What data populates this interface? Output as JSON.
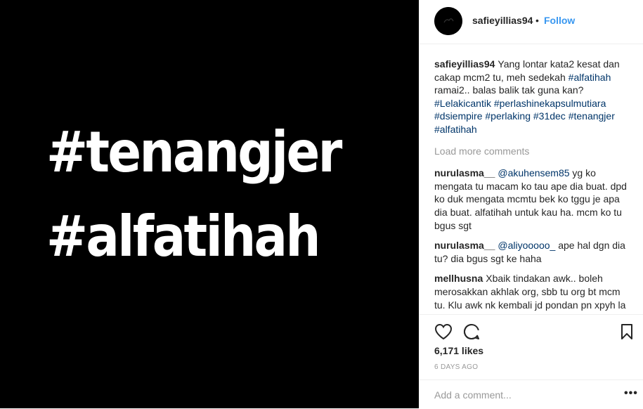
{
  "post_image": {
    "line1": "#tenangjer",
    "line2": "#alfatihah"
  },
  "header": {
    "username": "safieyillias94",
    "separator": "•",
    "follow_label": "Follow",
    "avatar_icon": "avatar-icon"
  },
  "caption": {
    "username": "safieyillias94",
    "segments": [
      {
        "type": "text",
        "text": "Yang lontar kata2 kesat dan cakap mcm2 tu, meh sedekah "
      },
      {
        "type": "hashtag",
        "text": "#alfatihah"
      },
      {
        "type": "text",
        "text": " ramai2.. balas balik tak guna kan? "
      },
      {
        "type": "hashtag",
        "text": "#Lelakicantik"
      },
      {
        "type": "text",
        "text": " "
      },
      {
        "type": "hashtag",
        "text": "#perlashinekapsulmutiara"
      },
      {
        "type": "text",
        "text": " "
      },
      {
        "type": "hashtag",
        "text": "#dsiempire"
      },
      {
        "type": "text",
        "text": " "
      },
      {
        "type": "hashtag",
        "text": "#perlaking"
      },
      {
        "type": "text",
        "text": " "
      },
      {
        "type": "hashtag",
        "text": "#31dec"
      },
      {
        "type": "text",
        "text": " "
      },
      {
        "type": "hashtag",
        "text": "#tenangjer"
      },
      {
        "type": "text",
        "text": " "
      },
      {
        "type": "hashtag",
        "text": "#alfatihah"
      }
    ]
  },
  "load_more_label": "Load more comments",
  "comments": [
    {
      "username": "nurulasma__",
      "mention": "@akuhensem85",
      "text": " yg ko mengata tu macam ko tau ape dia buat. dpd ko duk mengata mcmtu bek ko tggu je apa dia buat. alfatihah untuk kau ha. mcm ko tu bgus sgt"
    },
    {
      "username": "nurulasma__",
      "mention": "@aliyooooo_",
      "text": " ape hal dgn dia tu? dia bgus sgt ke haha"
    },
    {
      "username": "mellhusna",
      "mention": "",
      "text": "Xbaik tindakan awk.. boleh merosakkan akhlak org, sbb tu org bt mcm tu. Klu awk nk kembali jd pondan pn xpyh la post gambar drag awk dgn boyfriend and bg nasihat yg"
    }
  ],
  "actions": {
    "like_icon": "heart-icon",
    "comment_icon": "comment-icon",
    "save_icon": "bookmark-icon"
  },
  "likes": "6,171 likes",
  "timestamp": "6 DAYS AGO",
  "add_comment": {
    "placeholder": "Add a comment...",
    "more_label": "•••"
  }
}
